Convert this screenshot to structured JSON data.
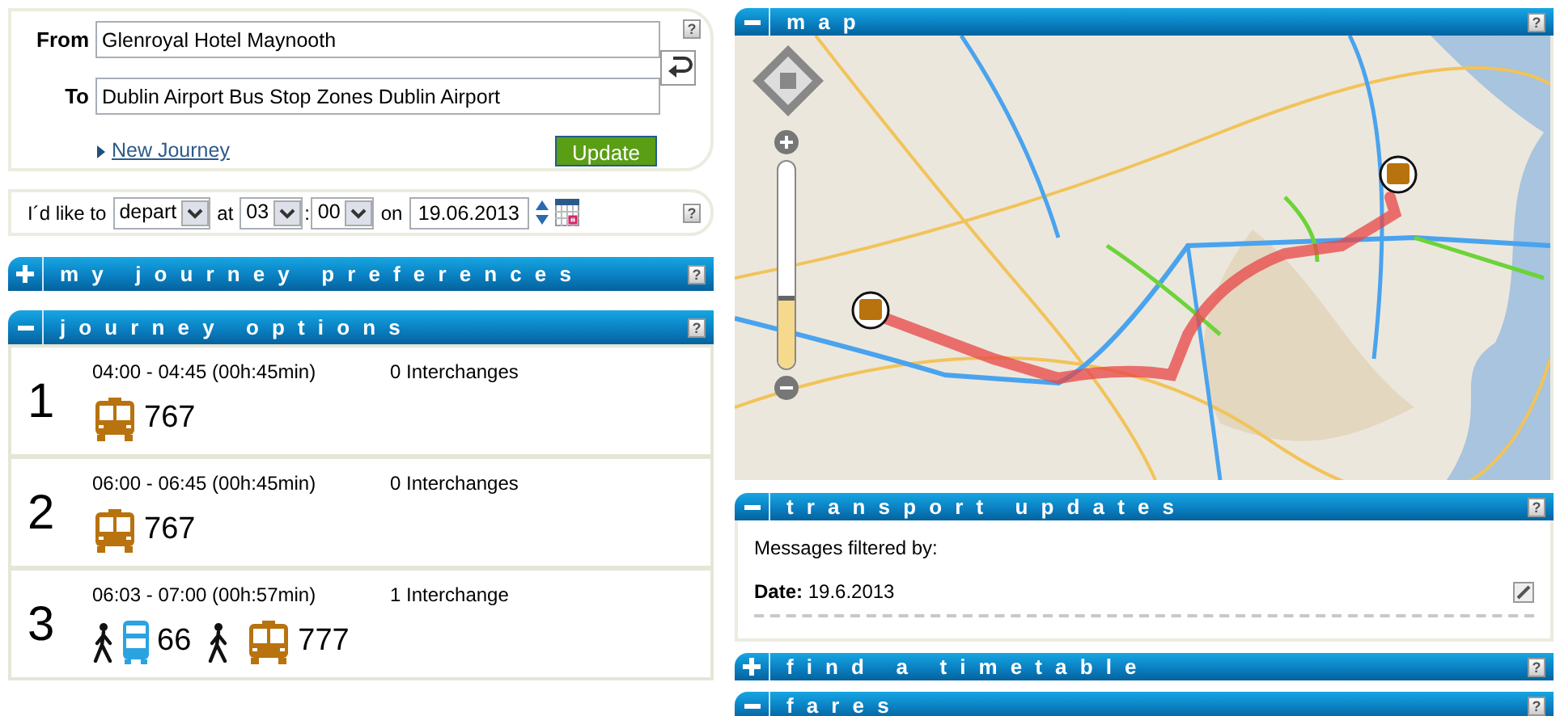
{
  "journey_form": {
    "from": {
      "label": "From",
      "value": "Glenroyal Hotel Maynooth"
    },
    "to": {
      "label": "To",
      "value": "Dublin Airport Bus Stop Zones Dublin Airport"
    },
    "help": "?",
    "new_journey_link": "New Journey",
    "update_button": "Update"
  },
  "time_selector": {
    "prefix": "I´d like to",
    "mode": "depart",
    "at_label": "at",
    "hour": "03",
    "separator": ":",
    "minute": "00",
    "on_label": "on",
    "date": "19.06.2013",
    "help": "?"
  },
  "left_panels": [
    {
      "title": "my journey preferences",
      "expanded": false,
      "help": "?"
    },
    {
      "title": "journey options",
      "expanded": true,
      "help": "?"
    }
  ],
  "journeys": [
    {
      "number": "1",
      "times": "04:00 - 04:45 (00h:45min)",
      "interchanges": "0 Interchanges",
      "legs": [
        {
          "kind": "coach",
          "route": "767"
        }
      ]
    },
    {
      "number": "2",
      "times": "06:00 - 06:45 (00h:45min)",
      "interchanges": "0 Interchanges",
      "legs": [
        {
          "kind": "coach",
          "route": "767"
        }
      ]
    },
    {
      "number": "3",
      "times": "06:03 - 07:00 (00h:57min)",
      "interchanges": "1 Interchange",
      "legs": [
        {
          "kind": "walk"
        },
        {
          "kind": "bus",
          "route": "66"
        },
        {
          "kind": "walk"
        },
        {
          "kind": "coach",
          "route": "777"
        }
      ]
    }
  ],
  "map_panel": {
    "title": "map",
    "expanded": true,
    "help": "?",
    "zoom": {
      "level": 0.35
    }
  },
  "transport_updates": {
    "title": "transport updates",
    "expanded": true,
    "help": "?",
    "intro": "Messages filtered by:",
    "date_line": "**Date:** 19.6.2013"
  },
  "more_panels": [
    {
      "title": "find a timetable",
      "expanded": false,
      "help": "?"
    },
    {
      "title": "fares",
      "expanded": true,
      "help": "?"
    }
  ]
}
